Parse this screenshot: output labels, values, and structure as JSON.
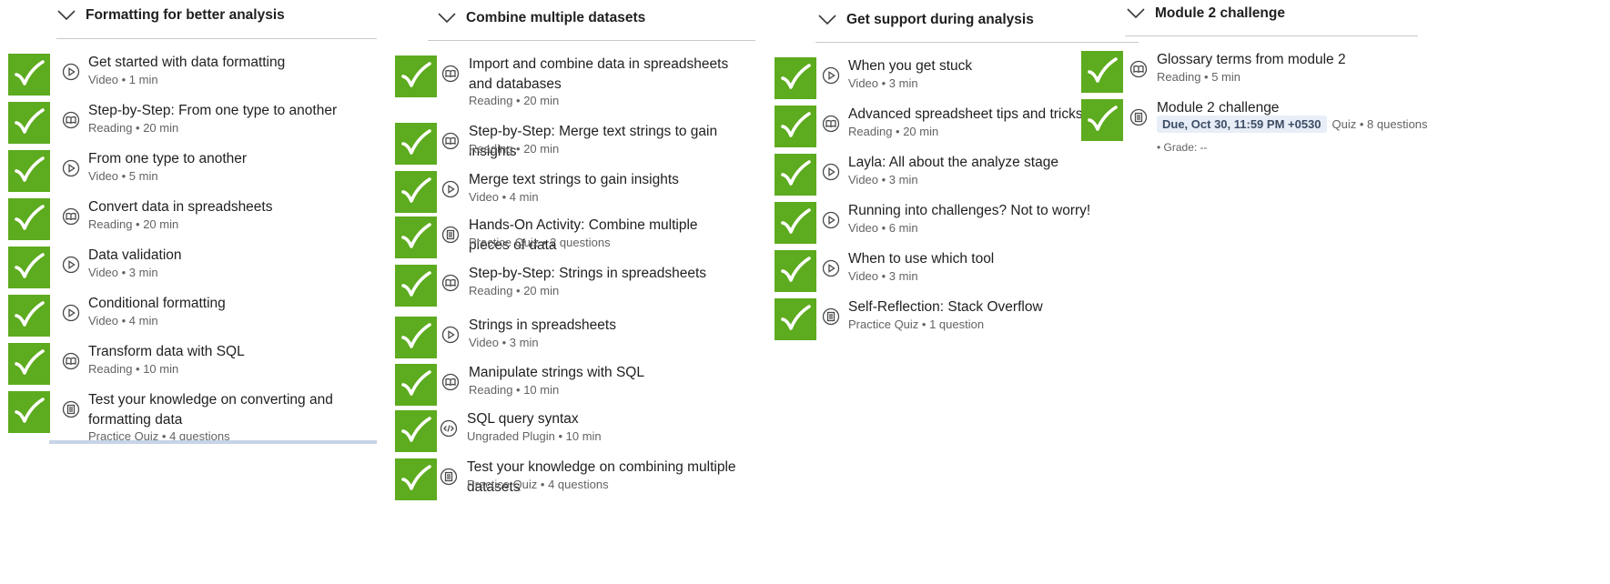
{
  "colors": {
    "check": "#5dab1e",
    "text": "#1f1f1f",
    "meta": "#636363",
    "due_bg": "#e8eef8"
  },
  "modules": [
    {
      "title": "Formatting for better analysis",
      "items": [
        {
          "title": "Get started with data formatting",
          "meta": "Video • 1 min",
          "icon": "play-icon"
        },
        {
          "title": "Step-by-Step: From one type to another",
          "meta": "Reading • 20 min",
          "icon": "book-icon"
        },
        {
          "title": "From one type to another",
          "meta": "Video • 5 min",
          "icon": "play-icon"
        },
        {
          "title": "Convert data in spreadsheets",
          "meta": "Reading • 20 min",
          "icon": "book-icon"
        },
        {
          "title": "Data validation",
          "meta": "Video • 3 min",
          "icon": "play-icon"
        },
        {
          "title": "Conditional formatting",
          "meta": "Video • 4 min",
          "icon": "play-icon"
        },
        {
          "title": "Transform data with SQL",
          "meta": "Reading • 10 min",
          "icon": "book-icon"
        },
        {
          "title": "Test your knowledge on converting and formatting data",
          "meta": "Practice Quiz • 4 questions",
          "icon": "quiz-icon"
        }
      ]
    },
    {
      "title": "Combine multiple datasets",
      "items": [
        {
          "title": "Import and combine data in spreadsheets and databases",
          "meta": "Reading • 20 min",
          "icon": "book-icon"
        },
        {
          "title": "Step-by-Step: Merge text strings to gain insights",
          "meta": "Reading • 20 min",
          "icon": "book-icon"
        },
        {
          "title": "Merge text strings to gain insights",
          "meta": "Video • 4 min",
          "icon": "play-icon"
        },
        {
          "title": "Hands-On Activity: Combine multiple pieces of data",
          "meta": "Practice Quiz • 2 questions",
          "icon": "quiz-icon"
        },
        {
          "title": "Step-by-Step: Strings in spreadsheets",
          "meta": "Reading • 20 min",
          "icon": "book-icon"
        },
        {
          "title": "Strings in spreadsheets",
          "meta": "Video • 3 min",
          "icon": "play-icon"
        },
        {
          "title": "Manipulate strings with SQL",
          "meta": "Reading • 10 min",
          "icon": "book-icon"
        },
        {
          "title": "SQL query syntax",
          "meta": "Ungraded Plugin • 10 min",
          "icon": "code-icon"
        },
        {
          "title": "Test your knowledge on combining multiple datasets",
          "meta": "Practice Quiz • 4 questions",
          "icon": "quiz-icon"
        }
      ]
    },
    {
      "title": "Get support during analysis",
      "items": [
        {
          "title": "When you get stuck",
          "meta": "Video • 3 min",
          "icon": "play-icon"
        },
        {
          "title": "Advanced spreadsheet tips and tricks",
          "meta": "Reading • 20 min",
          "icon": "book-icon"
        },
        {
          "title": "Layla: All about the analyze stage",
          "meta": "Video • 3 min",
          "icon": "play-icon"
        },
        {
          "title": "Running into challenges? Not to worry!",
          "meta": "Video • 6 min",
          "icon": "play-icon"
        },
        {
          "title": "When to use which tool",
          "meta": "Video • 3 min",
          "icon": "play-icon"
        },
        {
          "title": "Self-Reflection: Stack Overflow",
          "meta": "Practice Quiz • 1 question",
          "icon": "quiz-icon"
        }
      ]
    },
    {
      "title": "Module 2 challenge",
      "items": [
        {
          "title": "Glossary terms from module 2",
          "meta": "Reading • 5 min",
          "icon": "book-icon"
        },
        {
          "title": "Module 2 challenge",
          "due": "Due, Oct 30, 11:59 PM +0530",
          "meta": "Quiz • 8 questions",
          "grade": "• Grade: --",
          "icon": "quiz-icon"
        }
      ]
    }
  ]
}
